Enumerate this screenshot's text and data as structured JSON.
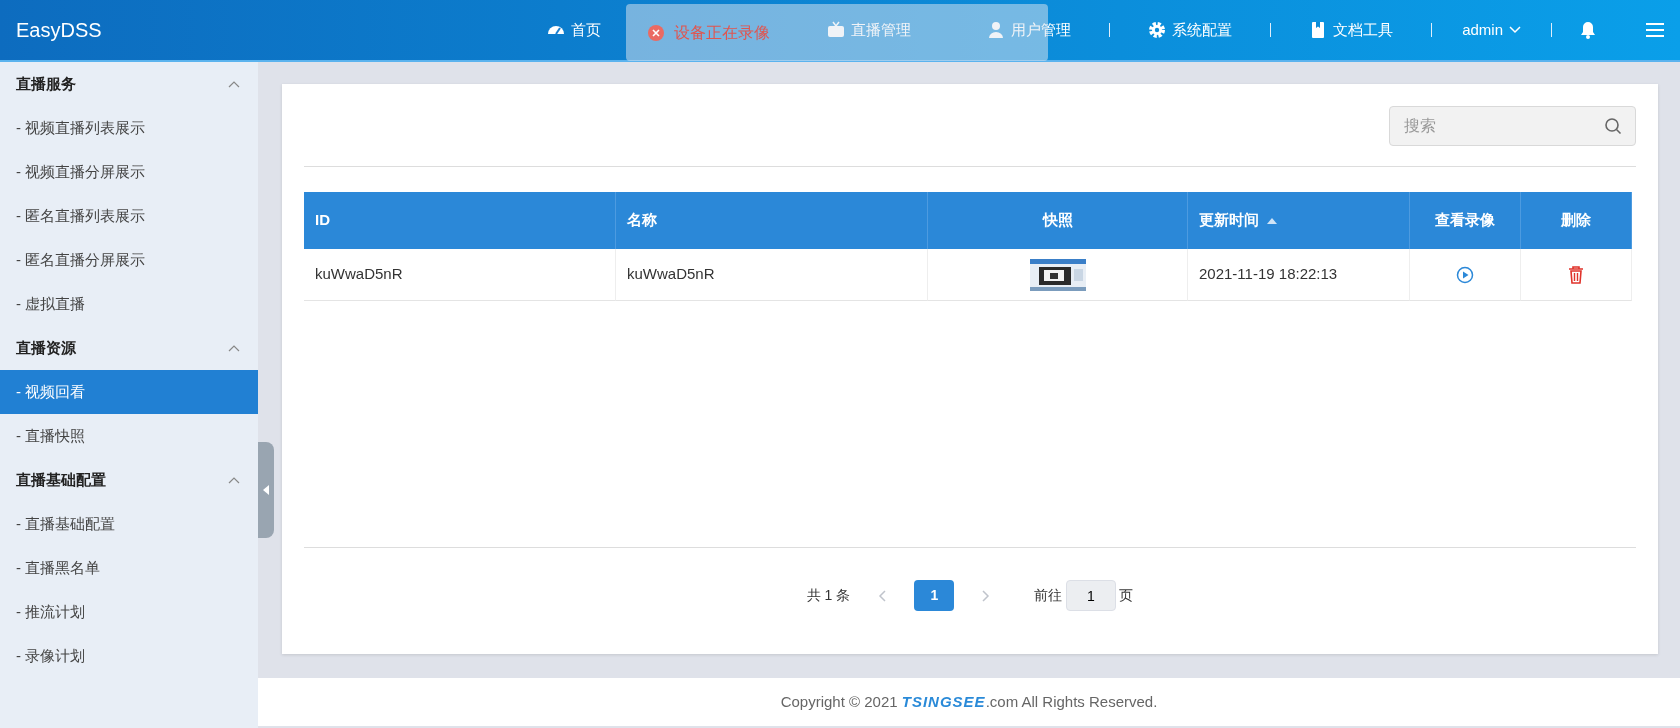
{
  "navbar": {
    "brand": "EasyDSS",
    "items": [
      {
        "label": "首页"
      },
      {
        "label": "直播管理"
      },
      {
        "label": "用户管理"
      },
      {
        "label": "系统配置"
      },
      {
        "label": "文档工具"
      }
    ],
    "user": "admin"
  },
  "toast": {
    "text": "设备正在录像",
    "kind": "error"
  },
  "sidebar": {
    "groups": [
      {
        "title": "直播服务",
        "expanded": true,
        "children": [
          {
            "label": "- 视频直播列表展示",
            "selected": false
          },
          {
            "label": "- 视频直播分屏展示",
            "selected": false
          },
          {
            "label": "- 匿名直播列表展示",
            "selected": false
          },
          {
            "label": "- 匿名直播分屏展示",
            "selected": false
          },
          {
            "label": "- 虚拟直播",
            "selected": false
          }
        ]
      },
      {
        "title": "直播资源",
        "expanded": true,
        "children": [
          {
            "label": "- 视频回看",
            "selected": true
          },
          {
            "label": "- 直播快照",
            "selected": false
          }
        ]
      },
      {
        "title": "直播基础配置",
        "expanded": true,
        "children": [
          {
            "label": "- 直播基础配置",
            "selected": false
          },
          {
            "label": "- 直播黑名单",
            "selected": false
          },
          {
            "label": "- 推流计划",
            "selected": false
          },
          {
            "label": "- 录像计划",
            "selected": false
          }
        ]
      }
    ]
  },
  "search": {
    "placeholder": "搜索"
  },
  "table": {
    "columns": [
      {
        "label": "ID",
        "sorted": false
      },
      {
        "label": "名称",
        "sorted": false
      },
      {
        "label": "快照",
        "sorted": false
      },
      {
        "label": "更新时间",
        "sorted": true
      },
      {
        "label": "查看录像",
        "sorted": false
      },
      {
        "label": "删除",
        "sorted": false
      }
    ],
    "rows": [
      {
        "id": "kuWwaD5nR",
        "name": "kuWwaD5nR",
        "updated": "2021-11-19 18:22:13"
      }
    ]
  },
  "pagination": {
    "total": "共 1 条",
    "pages": [
      {
        "label": "1",
        "selected": true
      }
    ],
    "goto_label": "前往",
    "goto_value": "1",
    "goto_suffix": "页"
  },
  "footer": {
    "prefix": "Copyright © 2021 ",
    "brand": "TSINGSEE",
    "suffix": ".com All Rights Reserved."
  }
}
